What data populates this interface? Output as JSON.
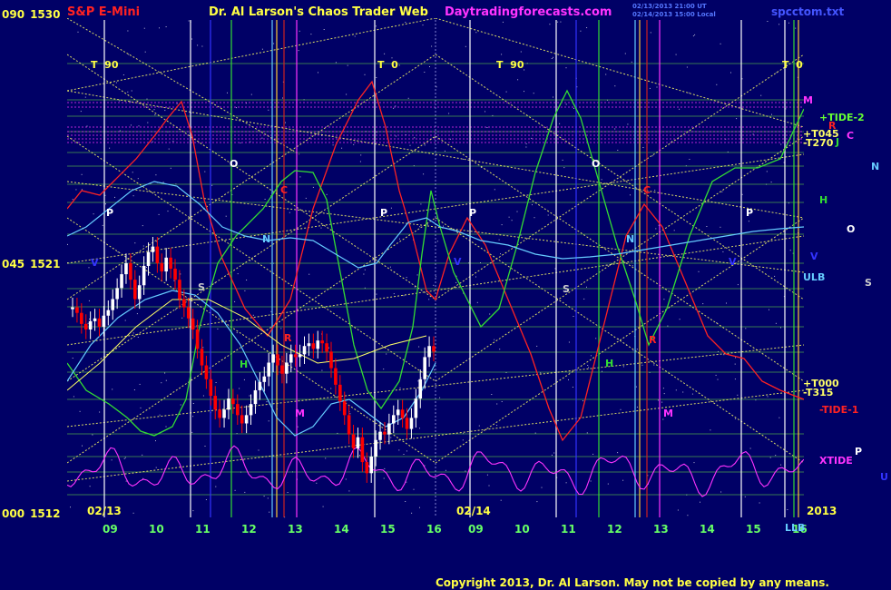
{
  "header": {
    "instrument": "S&P E-Mini",
    "title": "Dr. Al Larson's Chaos Trader Web",
    "website": "Daytradingforecasts.com",
    "timestamp_line1": "02/13/2013 21:00 UT",
    "timestamp_line2": "02/14/2013 15:00 Local",
    "filename": "spcctom.txt"
  },
  "copyright": "Copyright 2013, Dr. Al Larson. May not be copied by any means.",
  "colors": {
    "background": "#000066",
    "price_up": "#ffffff",
    "price_down": "#ff0000",
    "yellow_grid": "#ffff66",
    "green_grid": "#66dd44",
    "white_vert": "#ffffff",
    "magenta": "#ff33ff",
    "cyan": "#66ccff",
    "red": "#ff2222",
    "green": "#33dd33",
    "blue": "#3333ff",
    "date_label": "#66ff66"
  },
  "chart_data": {
    "type": "candlestick_with_cycle_overlays",
    "y_axis_labels": [
      {
        "angle": "090",
        "price": "1530",
        "value": 1530
      },
      {
        "angle": "045",
        "price": "1521",
        "value": 1521
      },
      {
        "angle": "000",
        "price": "1512",
        "value": 1512
      }
    ],
    "ylim": [
      1512,
      1530
    ],
    "x_dates": [
      "02/13",
      "02/14",
      "2013"
    ],
    "x_hours_day1": [
      "09",
      "10",
      "11",
      "12",
      "13",
      "14",
      "15",
      "16"
    ],
    "x_hours_day2": [
      "09",
      "10",
      "11",
      "12",
      "13",
      "14",
      "15",
      "16"
    ],
    "top_markers": [
      {
        "text": "T  90"
      },
      {
        "text": "T  0"
      },
      {
        "text": "T  90"
      },
      {
        "text": "T  0"
      }
    ],
    "right_labels": [
      {
        "text": "M",
        "color": "#ff33ff"
      },
      {
        "text": "+TIDE-2",
        "color": "#66ff33"
      },
      {
        "text": "R",
        "color": "#ff2222"
      },
      {
        "text": "+T045",
        "color": "#ffff66"
      },
      {
        "text": "C",
        "color": "#ff33ff"
      },
      {
        "text": "-T270",
        "color": "#ffff66"
      },
      {
        "text": "J",
        "color": "#33dd33"
      },
      {
        "text": "N",
        "color": "#66ccff"
      },
      {
        "text": "H",
        "color": "#33dd33"
      },
      {
        "text": "O",
        "color": "#ffffff"
      },
      {
        "text": "V",
        "color": "#3333ff"
      },
      {
        "text": "ULB",
        "color": "#66ccff"
      },
      {
        "text": "S",
        "color": "#cccccc"
      },
      {
        "text": "+T000",
        "color": "#ffff66"
      },
      {
        "text": "-T315",
        "color": "#ffff66"
      },
      {
        "text": "-TIDE-1",
        "color": "#ff2222"
      },
      {
        "text": "P",
        "color": "#ffffff"
      },
      {
        "text": "XTIDE",
        "color": "#ff33ff"
      },
      {
        "text": "U",
        "color": "#3333ff"
      },
      {
        "text": "LLB",
        "color": "#66ccff"
      }
    ],
    "in_chart_labels": [
      {
        "text": "V",
        "color": "#3333ff"
      },
      {
        "text": "P",
        "color": "#ffffff"
      },
      {
        "text": "O",
        "color": "#ffffff"
      },
      {
        "text": "S",
        "color": "#cccccc"
      },
      {
        "text": "C",
        "color": "#ff2222"
      },
      {
        "text": "N",
        "color": "#66ccff"
      },
      {
        "text": "H",
        "color": "#33dd33"
      },
      {
        "text": "R",
        "color": "#ff2222"
      },
      {
        "text": "M",
        "color": "#ff33ff"
      },
      {
        "text": "P",
        "color": "#ffffff"
      },
      {
        "text": "P",
        "color": "#ffffff"
      },
      {
        "text": "V",
        "color": "#3333ff"
      },
      {
        "text": "O",
        "color": "#ffffff"
      },
      {
        "text": "S",
        "color": "#cccccc"
      },
      {
        "text": "N",
        "color": "#66ccff"
      },
      {
        "text": "C",
        "color": "#ff2222"
      },
      {
        "text": "H",
        "color": "#33dd33"
      },
      {
        "text": "R",
        "color": "#ff2222"
      },
      {
        "text": "M",
        "color": "#ff33ff"
      },
      {
        "text": "V",
        "color": "#3333ff"
      },
      {
        "text": "P",
        "color": "#ffffff"
      }
    ],
    "price_bars_day1": [
      1519.6,
      1519.4,
      1519.0,
      1518.8,
      1519.1,
      1519.2,
      1518.9,
      1519.3,
      1519.5,
      1519.9,
      1520.3,
      1520.8,
      1521.2,
      1520.6,
      1519.9,
      1520.4,
      1521.1,
      1521.6,
      1521.8,
      1521.2,
      1520.9,
      1521.4,
      1521.0,
      1520.6,
      1519.9,
      1519.6,
      1519.2,
      1518.8,
      1518.1,
      1517.5,
      1517.0,
      1516.4,
      1515.9,
      1515.6,
      1515.9,
      1516.3,
      1516.1,
      1515.7,
      1515.4,
      1515.7,
      1516.1,
      1516.6,
      1516.9,
      1517.1,
      1517.6,
      1517.9,
      1517.5,
      1517.2,
      1517.6,
      1517.9,
      1517.8,
      1517.9,
      1518.2,
      1518.3,
      1518.1,
      1518.4,
      1518.3,
      1518.0,
      1517.4,
      1516.8,
      1516.2,
      1515.7,
      1515.0,
      1514.5,
      1514.9,
      1514.0,
      1513.6,
      1514.2,
      1514.8,
      1515.1,
      1515.0,
      1515.4,
      1515.7,
      1515.9,
      1515.6,
      1515.2,
      1515.6,
      1516.3,
      1517.0,
      1517.8,
      1518.2,
      1518.0
    ]
  }
}
